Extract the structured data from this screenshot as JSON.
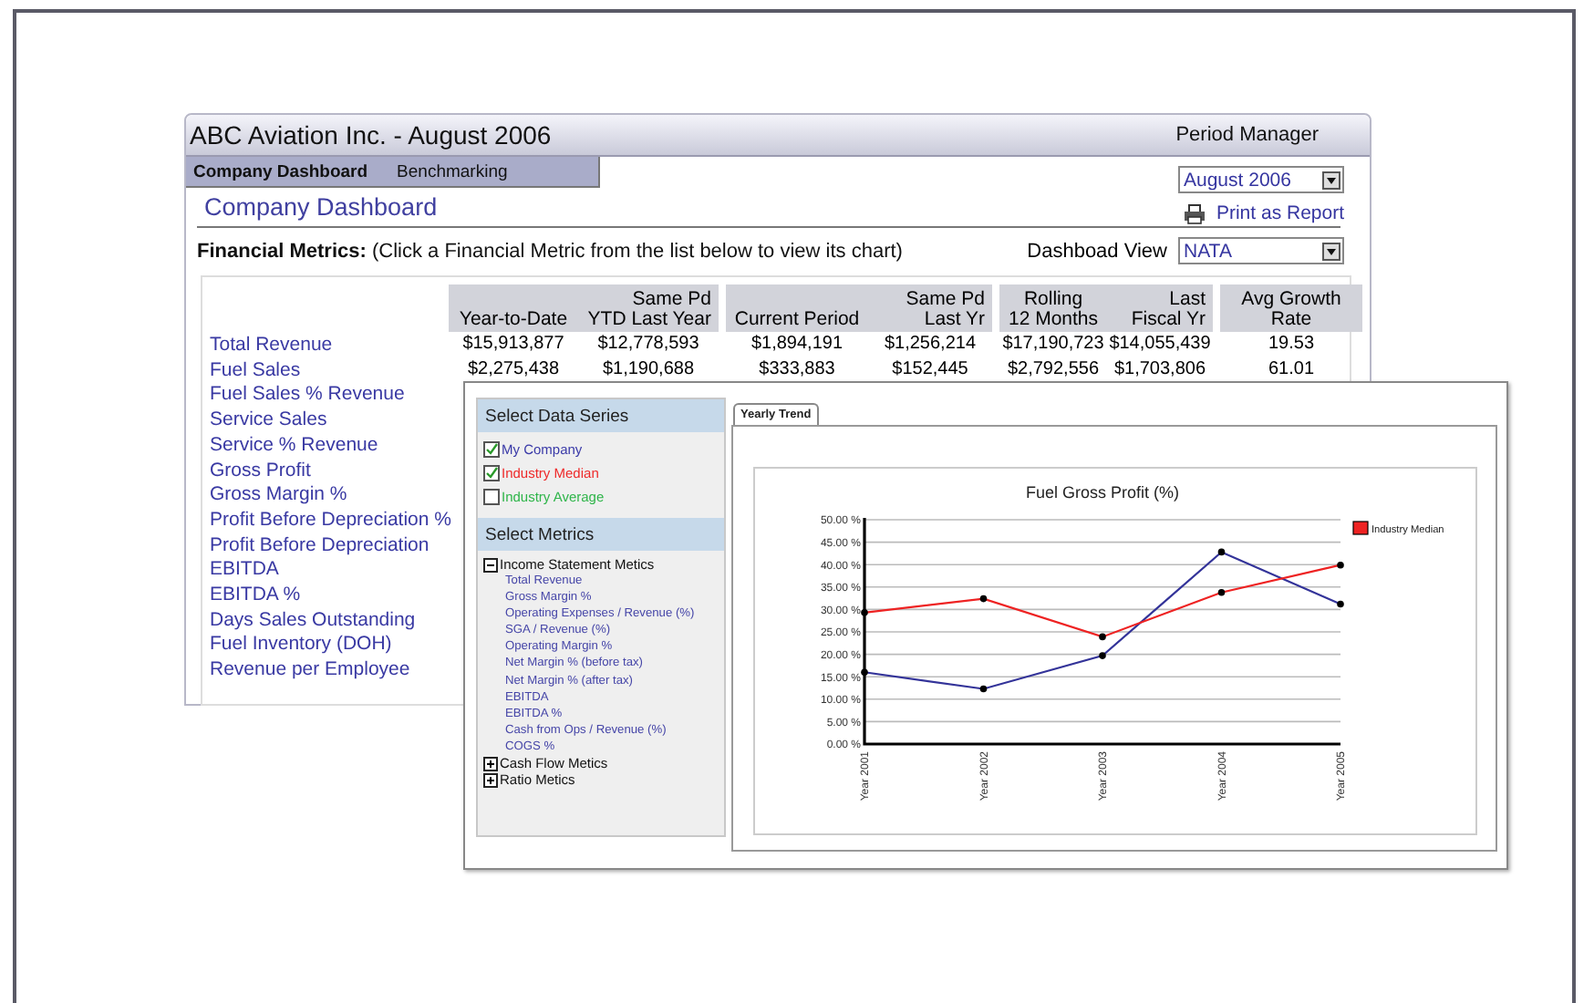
{
  "header": {
    "title": "ABC Aviation Inc. - August 2006",
    "period_manager": "Period Manager"
  },
  "tabs": [
    {
      "label": "Company Dashboard",
      "selected": true
    },
    {
      "label": "Benchmarking",
      "selected": false
    }
  ],
  "period_select": {
    "value": "August 2006"
  },
  "page_title": "Company Dashboard",
  "print_link": "Print as Report",
  "financial_metrics": {
    "label": "Financial Metrics:",
    "hint": "(Click a Financial Metric from the list below to view its chart)"
  },
  "dashboard_view": {
    "label": "Dashboad View",
    "value": "NATA"
  },
  "metrics": [
    "Total Revenue",
    "Fuel Sales",
    "Fuel Sales % Revenue",
    "Service Sales",
    "Service % Revenue",
    "Gross Profit",
    "Gross Margin %",
    "Profit Before Depreciation %",
    "Profit Before Depreciation",
    "EBITDA",
    "EBITDA %",
    "Days Sales Outstanding",
    "Fuel Inventory (DOH)",
    "Revenue per Employee"
  ],
  "table": {
    "column_groups": [
      {
        "columns": [
          "Year-to-Date",
          "Same Pd\nYTD Last Year"
        ]
      },
      {
        "columns": [
          "Current Period",
          "Same Pd\nLast Yr"
        ]
      },
      {
        "columns": [
          "Rolling\n12 Months",
          "Last\nFiscal Yr"
        ]
      },
      {
        "columns": [
          "Avg Growth\nRate"
        ]
      }
    ],
    "rows": [
      [
        "$15,913,877",
        "$12,778,593",
        "$1,894,191",
        "$1,256,214",
        "$17,190,723",
        "$14,055,439",
        "19.53"
      ],
      [
        "$2,275,438",
        "$1,190,688",
        "$333,883",
        "$152,445",
        "$2,792,556",
        "$1,703,806",
        "61.01"
      ]
    ]
  },
  "popup": {
    "series_title": "Select Data Series",
    "series": [
      {
        "label": "My Company",
        "checked": true,
        "color": "#3a3aa8"
      },
      {
        "label": "Industry Median",
        "checked": true,
        "color": "#ee2a2a"
      },
      {
        "label": "Industry Average",
        "checked": false,
        "color": "#2fb54a"
      }
    ],
    "metrics_title": "Select Metrics",
    "groups": [
      {
        "label": "Income Statement Metics",
        "expanded": true,
        "children": [
          {
            "label": "Total Revenue"
          },
          {
            "label": "Gross Margin %"
          },
          {
            "label": "Operating Expenses / Revenue (%)"
          },
          {
            "label": "SGA / Revenue (%)"
          },
          {
            "label": "Operating Margin %"
          },
          {
            "label": "Net Margin % (before tax)"
          },
          {
            "label": "Net Margin % (after tax)"
          },
          {
            "label": "EBITDA"
          },
          {
            "label": "EBITDA %"
          },
          {
            "label": "Cash from Ops / Revenue (%)"
          },
          {
            "label": "COGS %"
          }
        ]
      },
      {
        "label": "Cash Flow Metics",
        "expanded": false
      },
      {
        "label": "Ratio Metics",
        "expanded": false
      }
    ],
    "chart_tabs": [
      {
        "label": "Yearly Trend",
        "selected": true
      }
    ],
    "chart_data": {
      "type": "line",
      "title": "Fuel Gross Profit (%)",
      "categories": [
        "Year 2001",
        "Year 2002",
        "Year 2003",
        "Year 2004",
        "Year 2005"
      ],
      "series": [
        {
          "color": "#333399",
          "values": [
            16.0,
            12.3,
            19.7,
            42.8,
            31.2
          ],
          "marker": "circle"
        },
        {
          "name": "Industry Median",
          "color": "#ee2222",
          "values": [
            29.3,
            32.4,
            23.9,
            33.8,
            39.9
          ],
          "marker": "circle"
        }
      ],
      "ylim": [
        0,
        50
      ],
      "grid": true,
      "yticks": [
        {
          "value": 0,
          "label": "0.00 %"
        },
        {
          "value": 5,
          "label": "5.00 %"
        },
        {
          "value": 10,
          "label": "10.00 %"
        },
        {
          "value": 15,
          "label": "15.00 %"
        },
        {
          "value": 20,
          "label": "20.00 %"
        },
        {
          "value": 25,
          "label": "25.00 %"
        },
        {
          "value": 30,
          "label": "30.00 %"
        },
        {
          "value": 35,
          "label": "35.00 %"
        },
        {
          "value": 40,
          "label": "40.00 %"
        },
        {
          "value": 45,
          "label": "45.00 %"
        },
        {
          "value": 50,
          "label": "50.00 %"
        }
      ]
    }
  }
}
